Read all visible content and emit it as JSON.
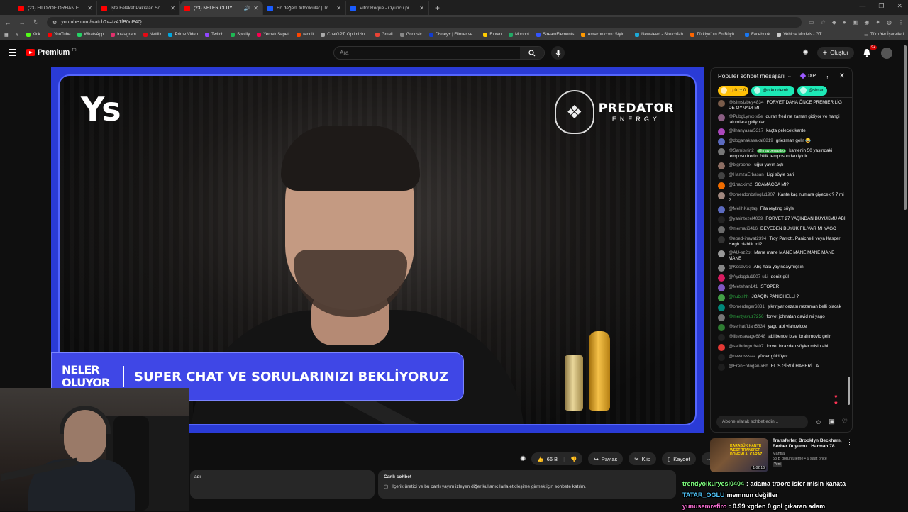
{
  "browser": {
    "tabs": [
      {
        "title": "(23) FİLOZOF ORHAN EV ZİYAR...",
        "color": "#ff0000",
        "active": false
      },
      {
        "title": "İşte Felaket Pakistan Sokak Le...",
        "color": "#ff0000",
        "active": false
      },
      {
        "title": "(23) NELER OLUYOR 42. BÖ...",
        "color": "#ff0000",
        "active": true
      },
      {
        "title": "En değerli futbolcular | Transfe...",
        "color": "#1a5cff",
        "active": false
      },
      {
        "title": "Vitor Roque - Oyuncu profili 20...",
        "color": "#1a5cff",
        "active": false
      }
    ],
    "url": "youtube.com/watch?v=tz41fB0nP4Q",
    "bookmarks": [
      {
        "label": "Kick",
        "color": "#53fc18"
      },
      {
        "label": "YouTube",
        "color": "#ff0000"
      },
      {
        "label": "WhatsApp",
        "color": "#25d366"
      },
      {
        "label": "Instagram",
        "color": "#e1306c"
      },
      {
        "label": "Netflix",
        "color": "#e50914"
      },
      {
        "label": "Prime Video",
        "color": "#00a8e1"
      },
      {
        "label": "Twitch",
        "color": "#9146ff"
      },
      {
        "label": "Spotify",
        "color": "#1db954"
      },
      {
        "label": "Yemek Sepeti",
        "color": "#fa0050"
      },
      {
        "label": "reddit",
        "color": "#ff4500"
      },
      {
        "label": "ChatGPT: Optimizin...",
        "color": "#aaaaaa"
      },
      {
        "label": "Gmail",
        "color": "#ea4335"
      },
      {
        "label": "Gnoosic",
        "color": "#888888"
      },
      {
        "label": "Disney+ | Filmler ve...",
        "color": "#113ccf"
      },
      {
        "label": "Exxen",
        "color": "#ffcc00"
      },
      {
        "label": "Moobot",
        "color": "#22aa66"
      },
      {
        "label": "StreamElements",
        "color": "#3355ff"
      },
      {
        "label": "Amazon.com: Stylo...",
        "color": "#ff9900"
      },
      {
        "label": "Newsfeed - Sketchfab",
        "color": "#1caad9"
      },
      {
        "label": "Türkiye'nin En Büyü...",
        "color": "#ff6600"
      },
      {
        "label": "Facebook",
        "color": "#1877f2"
      },
      {
        "label": "Vehicle Models - GT...",
        "color": "#cccccc"
      }
    ],
    "all_bookmarks": "Tüm Yer İşaretleri"
  },
  "header": {
    "logo_text": "Premium",
    "logo_region": "TR",
    "search_placeholder": "Ara",
    "create_label": "Oluştur",
    "notif_count": "9+"
  },
  "video": {
    "brand_logo": "Ys",
    "sponsor_name": "PREDATOR",
    "sponsor_sub": "ENERGY",
    "lower_left_1": "NELER",
    "lower_left_2": "OLUYOR",
    "lower_text": "SUPER CHAT VE SORULARINIZI BEKLİYORUZ"
  },
  "chat": {
    "title": "Popüler sohbet mesajları",
    "xp": "0XP",
    "ticker": [
      {
        "label": "👍0  🙂0",
        "color": "#ffc107"
      },
      {
        "label": "@orkundemir...",
        "color": "#1de9b6"
      },
      {
        "label": "@slman",
        "color": "#1de9b6"
      }
    ],
    "messages": [
      {
        "author": "@isimsizbey4834",
        "text": "FORVET DAHA ÖNCE PREMIER LİG DE OYNADI MI",
        "color": "#7a5c4a"
      },
      {
        "author": "@PubgLyrox-x9e",
        "text": "duran fred ne zaman gidiyor ve hangi takımlara gidiyolar",
        "color": "#8b5e83"
      },
      {
        "author": "@ilhanyasar5317",
        "text": "kaçta gelecek kante",
        "color": "#ab47bc"
      },
      {
        "author": "@doganakasakal6819",
        "text": "griezman gelir 😂",
        "color": "#5c6bc0"
      },
      {
        "author": "@Samisirin2",
        "badge": "@maybegastro",
        "text": "kantenin 50 yaşındaki temposu fredin 20lik temposundan iyidir",
        "color": "#777777"
      },
      {
        "author": "@bigroomx",
        "text": "uğur yayın açtı",
        "color": "#8d6e63"
      },
      {
        "author": "@HamzaErbasan",
        "text": "Ligi söyle bari",
        "color": "#444444"
      },
      {
        "author": "@1hackim2",
        "text": "SCAMACCA MI?",
        "color": "#ef6c00"
      },
      {
        "author": "@omerdonbaloglu1907",
        "text": "Kante kaç numara giyecek ? 7 mi ?",
        "color": "#a1887f"
      },
      {
        "author": "@MelihKuştaş",
        "text": "Fifa reyting söyle",
        "color": "#5c6bc0"
      },
      {
        "author": "@yasintezel4039",
        "text": "FORVET 27 YAŞINDAN BÜYÜKMÜ ABİ",
        "color": "#222222"
      },
      {
        "author": "@memati6416",
        "text": "DEVEDEN BÜYÜK FİL VAR MI YAGO",
        "color": "#6d6d6d"
      },
      {
        "author": "@ebed-ihayat2394",
        "text": "Troy Parrott, Panichelli veya Kasper Høgh olabilir mi?",
        "color": "#333333"
      },
      {
        "author": "@AU-sz2pt",
        "text": "Mane mane MANE MANE MANE MANE MANE",
        "color": "#999999"
      },
      {
        "author": "@Kosevski",
        "text": "Abş hala yayındaymışsın",
        "color": "#888888"
      },
      {
        "author": "@Aydogdu1907-u1i",
        "text": "deniz gül",
        "color": "#d81b60"
      },
      {
        "author": "@Metehan141",
        "text": "STOPER",
        "color": "#7e57c2"
      },
      {
        "author": "@nubishh",
        "text": "JOAQİN PANICHELLİ ?",
        "color": "#43a047",
        "green": true
      },
      {
        "author": "@omerdeger6831",
        "text": "şikrinyar cezası nezaman belli olacak",
        "color": "#00897b"
      },
      {
        "author": "@mertyavuz7256",
        "text": "forvet johnatan david mi yago",
        "color": "#777777",
        "green": true
      },
      {
        "author": "@serhatfidan5834",
        "text": "yago abi viahovicce",
        "color": "#2e7d32"
      },
      {
        "author": "@ilkersavage6848",
        "text": "abi bence bize ibrahimovic gelir",
        "color": "#222222"
      },
      {
        "author": "@salihdogru9407",
        "text": "forvet birazdan söyler misin abi",
        "color": "#e53935"
      },
      {
        "author": "@newosssss",
        "text": "yüzler güldüyor",
        "color": "#1e1e1e"
      },
      {
        "author": "@ErenErdoğan-x6b",
        "text": "ELİS GİRDİ HABERİ LA",
        "color": "#1e1e1e"
      }
    ],
    "input_placeholder": "Abone olarak sohbet edin..."
  },
  "actions": {
    "likes": "66 B",
    "share": "Paylaş",
    "clip": "Klip",
    "save": "Kaydet"
  },
  "description": {
    "fragment": "adı"
  },
  "live_chat_box": {
    "title": "Canlı sohbet",
    "text": "İçerik üretici ve bu canlı yayını izleyen diğer kullanıcılarla etkileşime girmek için sohbete katılın."
  },
  "related": {
    "title": "Transferler, Brooklyn Beckham, Berber Duyumu | Harman 78. ...",
    "channel": "Mantra",
    "meta": "53 B görüntüleme • 6 saat önce",
    "badge": "Yeni",
    "duration": "1:02:16",
    "thumb_text": "KARABÜK KANYE WEST TRANSFER DÖNEMİ ALCARAZ"
  },
  "overlay_chat": [
    {
      "user": "trendyolkuryesi0404",
      "msg": ": adama traore isler misin kanata",
      "color": "#7fff7f"
    },
    {
      "user": "TATAR_OGLU",
      "msg": "memnun değiller",
      "color": "#4fc3f7"
    },
    {
      "user": "yunusemrefiro",
      "msg": ": 0.99 xgden 0 gol çıkaran adam",
      "color": "#ff6fd8"
    }
  ]
}
